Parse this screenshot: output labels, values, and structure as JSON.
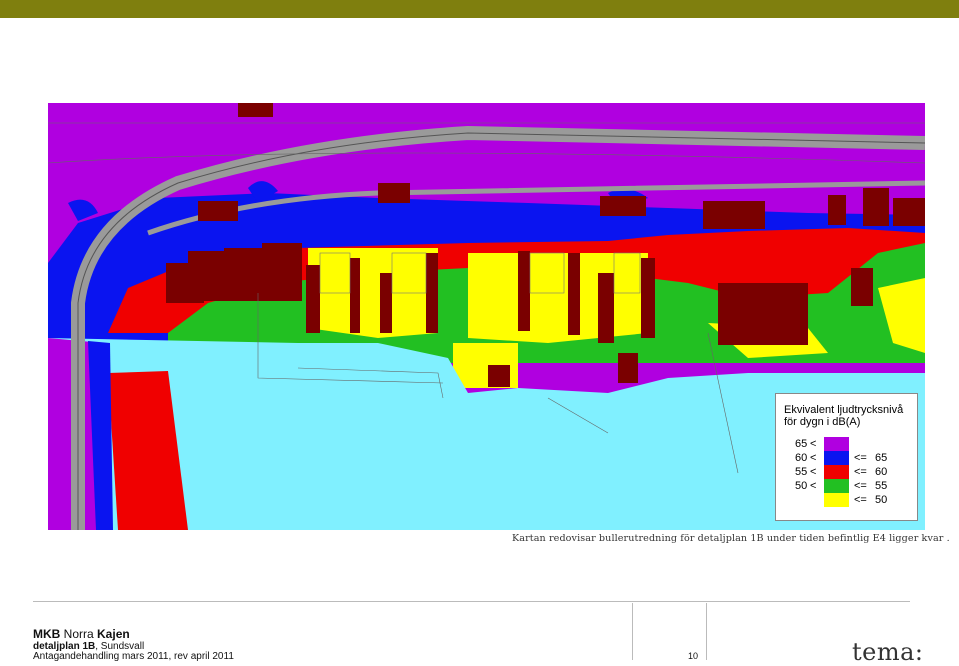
{
  "colors": {
    "topbar": "#7f7f0e",
    "water": "#80f0ff",
    "purple": "#b000e0",
    "blue": "#0a14f0",
    "red": "#f00000",
    "green": "#22c022",
    "yellow": "#ffff00",
    "building": "#7a0000"
  },
  "legend": {
    "title_line1": "Ekvivalent ljudtrycksnivå",
    "title_line2": "för dygn i dB(A)",
    "rows": [
      {
        "low": "65",
        "lt": "<",
        "color": "#b000e0",
        "le": "",
        "high": ""
      },
      {
        "low": "60",
        "lt": "<",
        "color": "#0a14f0",
        "le": "<=",
        "high": "65"
      },
      {
        "low": "55",
        "lt": "<",
        "color": "#f00000",
        "le": "<=",
        "high": "60"
      },
      {
        "low": "50",
        "lt": "<",
        "color": "#22c022",
        "le": "<=",
        "high": "55"
      },
      {
        "low": "",
        "lt": "",
        "color": "#ffff00",
        "le": "<=",
        "high": "50"
      }
    ]
  },
  "caption": "Kartan redovisar bullerutredning för detaljplan 1B under tiden befintlig E4 ligger kvar .",
  "footer": {
    "title_bold1": "MKB",
    "title_normal": " Norra ",
    "title_bold2": "Kajen",
    "line2_bold": "detaljplan 1B",
    "line2_rest": ", Sundsvall",
    "line3": "Antagandehandling mars 2011, rev april 2011",
    "page_number": "10",
    "logo": "tema:"
  }
}
